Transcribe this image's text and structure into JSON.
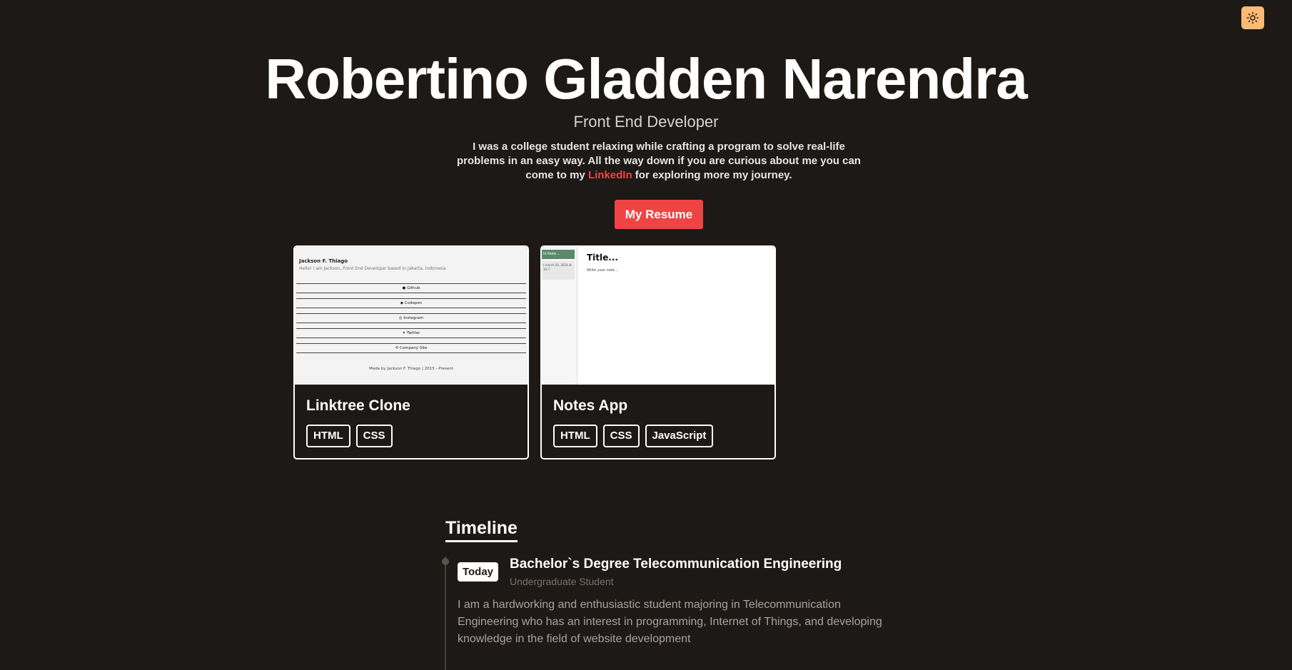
{
  "theme_toggle": {
    "icon": "sun-icon"
  },
  "hero": {
    "name": "Robertino Gladden Narendra",
    "role": "Front End Developer",
    "bio_before": "I was a college student relaxing while crafting a program to solve real-life problems in an easy way. All the way down if you are curious about me you can come to my ",
    "bio_link": "LinkedIn",
    "bio_after": " for exploring more my journey.",
    "resume_button": "My Resume"
  },
  "projects": [
    {
      "title": "Linktree Clone",
      "tags": [
        "HTML",
        "CSS"
      ],
      "preview": {
        "name": "Jackson F. Thiago",
        "subtitle": "Hello! I am Jackson, Front End Developer based in Jakarta, Indonesia",
        "links": [
          "Github",
          "Codepen",
          "Instagram",
          "Twitter",
          "Company Site"
        ],
        "footer": "Made by Jackson F. Thiago | 2015 - Present"
      }
    },
    {
      "title": "Notes App",
      "tags": [
        "HTML",
        "CSS",
        "JavaScript"
      ],
      "preview": {
        "sidebar_head": "ld Note...",
        "sidebar_item": "t\nmarch 29, 2024 at 10:7",
        "note_title": "Title...",
        "note_text": "Write your note..."
      }
    }
  ],
  "timeline": {
    "heading": "Timeline",
    "items": [
      {
        "badge": "Today",
        "title": "Bachelor`s Degree Telecommunication Engineering",
        "subtitle": "Undergraduate Student",
        "description": "I am a hardworking and enthusiastic student majoring in Telecommunication Engineering who has an interest in programming, Internet of Things, and developing knowledge in the field of website development"
      }
    ]
  },
  "colors": {
    "background": "#1d1917",
    "accent": "#ef4444",
    "toggle": "#fdba74"
  }
}
